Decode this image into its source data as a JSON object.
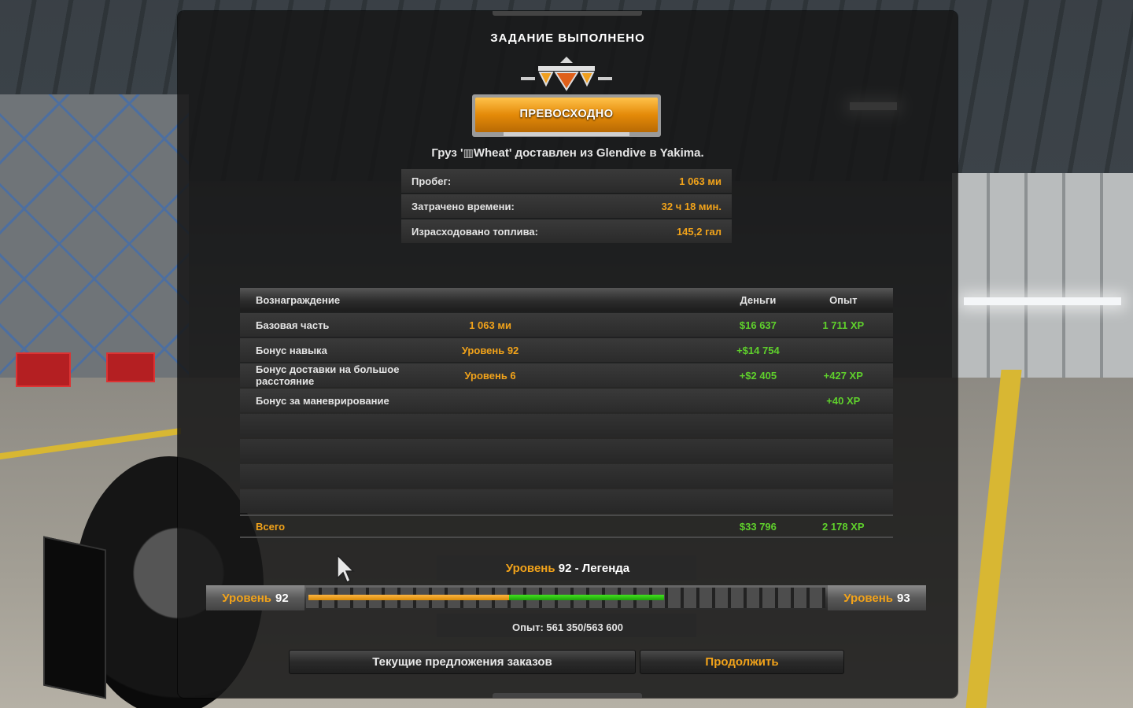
{
  "window": {
    "title": "ЗАДАНИЕ ВЫПОЛНЕНО"
  },
  "badge": {
    "label": "ПРЕВОСХОДНО",
    "icon": "award-emblem-icon"
  },
  "delivery": {
    "prefix": "Груз '",
    "cargo_icon": "cargo-box-icon",
    "cargo": "Wheat",
    "suffix": "' доставлен из Glendive в Yakima."
  },
  "stats": [
    {
      "label": "Пробег:",
      "value": "1 063 ми"
    },
    {
      "label": "Затрачено времени:",
      "value": "32 ч 18 мин."
    },
    {
      "label": "Израсходовано топлива:",
      "value": "145,2 гал"
    }
  ],
  "rewards": {
    "headers": {
      "reward": "Вознаграждение",
      "money": "Деньги",
      "xp": "Опыт"
    },
    "rows": [
      {
        "name": "Базовая часть",
        "level": "1 063 ми",
        "money": "$16 637",
        "xp": "1 711 XP"
      },
      {
        "name": "Бонус навыка",
        "level": "Уровень 92",
        "money": "+$14 754",
        "xp": ""
      },
      {
        "name": "Бонус доставки на большое расстояние",
        "level": "Уровень 6",
        "money": "+$2 405",
        "xp": "+427 XP"
      },
      {
        "name": "Бонус за маневрирование",
        "level": "",
        "money": "",
        "xp": "+40 XP"
      }
    ],
    "total": {
      "name": "Всего",
      "money": "$33 796",
      "xp": "2 178 XP"
    }
  },
  "level": {
    "title_prefix": "Уровень",
    "title_rest": "92 - Легенда",
    "current_label": "Уровень",
    "current_value": "92",
    "next_label": "Уровень",
    "next_value": "93",
    "progress_before": 0.39,
    "progress_gained": 0.3,
    "xp_text": "Опыт: 561 350/563 600"
  },
  "buttons": {
    "offers": "Текущие предложения заказов",
    "continue": "Продолжить"
  },
  "colors": {
    "accent": "#f2a31a",
    "positive": "#5fd02c",
    "panel": "#161616"
  }
}
